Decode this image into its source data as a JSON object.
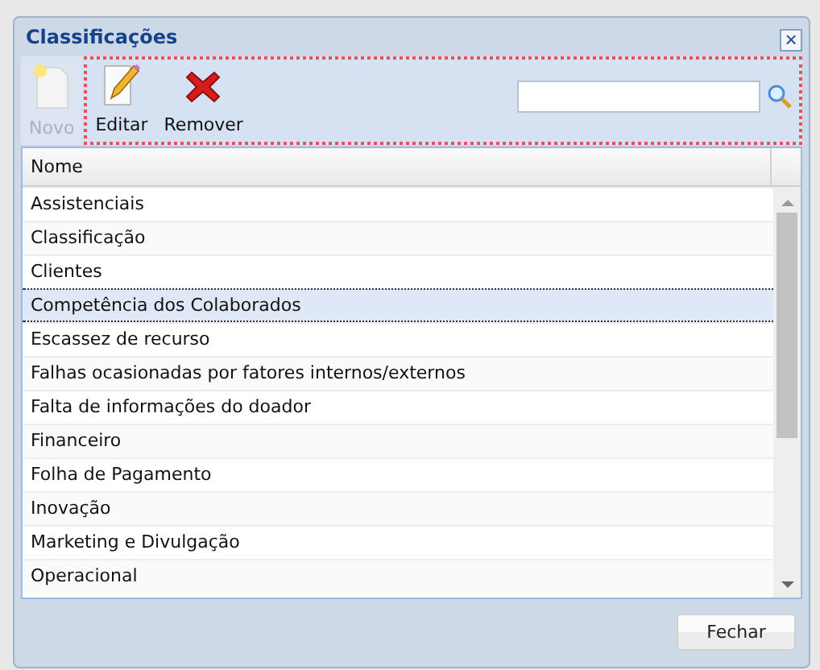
{
  "window": {
    "title": "Classificações",
    "close": "×"
  },
  "toolbar": {
    "buttons": [
      {
        "label": "Novo",
        "kind": "new",
        "disabled": true
      },
      {
        "label": "Editar",
        "kind": "edit",
        "disabled": false
      },
      {
        "label": "Remover",
        "kind": "remove",
        "disabled": false
      }
    ]
  },
  "table": {
    "columns": [
      "Nome"
    ],
    "rows": [
      {
        "name": "Assistenciais",
        "selected": false
      },
      {
        "name": "Classificação",
        "selected": false
      },
      {
        "name": "Clientes",
        "selected": false
      },
      {
        "name": "Competência dos Colaborados",
        "selected": true
      },
      {
        "name": "Escassez de recurso",
        "selected": false
      },
      {
        "name": "Falhas ocasionadas por fatores internos/externos",
        "selected": false
      },
      {
        "name": "Falta de informações do doador",
        "selected": false
      },
      {
        "name": "Financeiro",
        "selected": false
      },
      {
        "name": "Folha de Pagamento",
        "selected": false
      },
      {
        "name": "Inovação",
        "selected": false
      },
      {
        "name": "Marketing e Divulgação",
        "selected": false
      },
      {
        "name": "Operacional",
        "selected": false
      }
    ]
  },
  "footer": {
    "buttons": [
      "Fechar"
    ]
  }
}
